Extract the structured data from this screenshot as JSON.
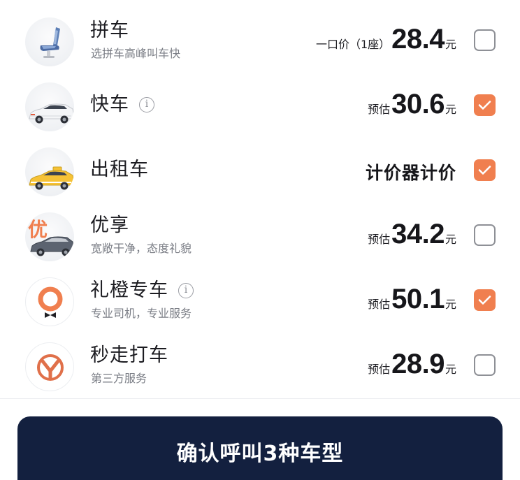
{
  "colors": {
    "accent": "#f07f4f",
    "button_bg": "#13203f",
    "text_primary": "#1c1c21",
    "text_secondary": "#7a7d85"
  },
  "ride_options": [
    {
      "name": "拼车",
      "subtitle": "选拼车高峰叫车快",
      "price_prefix": "一口价（1座）",
      "price_value": "28.4",
      "price_unit": "元",
      "checked": false,
      "icon": "car-seat-icon"
    },
    {
      "name": "快车",
      "has_info": true,
      "info_glyph": "i",
      "price_prefix": "预估",
      "price_value": "30.6",
      "price_unit": "元",
      "checked": true,
      "icon": "white-car-icon"
    },
    {
      "name": "出租车",
      "price_text": "计价器计价",
      "checked": true,
      "icon": "taxi-icon"
    },
    {
      "name": "优享",
      "subtitle": "宽敞干净，态度礼貌",
      "price_prefix": "预估",
      "price_value": "34.2",
      "price_unit": "元",
      "checked": false,
      "icon": "premium-car-icon",
      "badge_text": "优"
    },
    {
      "name": "礼橙专车",
      "has_info": true,
      "info_glyph": "i",
      "subtitle": "专业司机，专业服务",
      "price_prefix": "预估",
      "price_value": "50.1",
      "price_unit": "元",
      "checked": true,
      "icon": "orange-logo-icon"
    },
    {
      "name": "秒走打车",
      "subtitle": "第三方服务",
      "price_prefix": "预估",
      "price_value": "28.9",
      "price_unit": "元",
      "checked": false,
      "icon": "m-logo-icon"
    }
  ],
  "confirm_button": {
    "label": "确认呼叫3种车型"
  }
}
